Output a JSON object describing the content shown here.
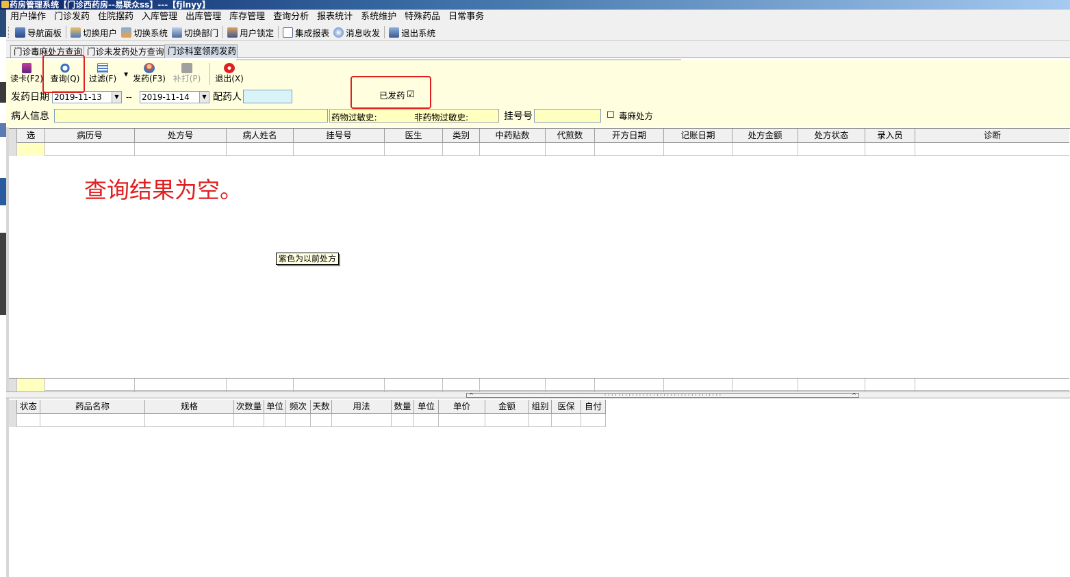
{
  "window": {
    "title": "药房管理系统【门诊西药房--易联众ss】---【fjlnyy】"
  },
  "menu": [
    "用户操作",
    "门诊发药",
    "住院摆药",
    "入库管理",
    "出库管理",
    "库存管理",
    "查询分析",
    "报表统计",
    "系统维护",
    "特殊药品",
    "日常事务"
  ],
  "toolbar": {
    "items": [
      {
        "label": "导航面板",
        "icon": "navigation-panel-icon"
      },
      {
        "label": "切换用户",
        "icon": "switch-user-icon"
      },
      {
        "label": "切换系统",
        "icon": "switch-system-icon"
      },
      {
        "label": "切换部门",
        "icon": "switch-department-icon"
      },
      {
        "label": "用户锁定",
        "icon": "user-lock-icon"
      },
      {
        "label": "集成报表",
        "icon": "report-icon"
      },
      {
        "label": "消息收发",
        "icon": "message-icon"
      },
      {
        "label": "退出系统",
        "icon": "exit-system-icon"
      }
    ]
  },
  "tabs": [
    "门诊毒麻处方查询",
    "门诊未发药处方查询",
    "门诊科室领药发药"
  ],
  "actions": {
    "read_card": "读卡(F2)",
    "query": "查询(Q)",
    "filter": "过滤(F)",
    "dispense": "发药(F3)",
    "reprint": "补打(P)",
    "exit": "退出(X)"
  },
  "filters": {
    "date_label": "发药日期",
    "date_from": "2019-11-13",
    "date_sep": "--",
    "date_to": "2019-11-14",
    "pharmacist_label": "配药人",
    "pharmacist_value": "",
    "dispensed_label": "已发药",
    "dispensed_checked": "☑",
    "patient_label": "病人信息",
    "patient_value": "",
    "drug_allergy_label": "药物过敏史:",
    "non_drug_allergy_label": "非药物过敏史:",
    "reg_no_label": "挂号号",
    "reg_no_value": "",
    "narcotic_label": "毒麻处方",
    "narcotic_checked": "☐"
  },
  "grid1": {
    "columns": [
      "选",
      "病历号",
      "处方号",
      "病人姓名",
      "挂号号",
      "医生",
      "类别",
      "中药贴数",
      "代煎数",
      "开方日期",
      "记账日期",
      "处方金额",
      "处方状态",
      "录入员",
      "诊断"
    ]
  },
  "annotation": "查询结果为空。",
  "tooltip": "紫色为以前处方",
  "grid2": {
    "columns": [
      "状态",
      "药品名称",
      "规格",
      "次数量",
      "单位",
      "频次",
      "天数",
      "用法",
      "数量",
      "单位",
      "单价",
      "金额",
      "组别",
      "医保",
      "自付"
    ]
  },
  "colors": {
    "highlight_box": "#e02020",
    "yellow_panel": "#ffffe0",
    "selected_cell": "#ffffc0"
  }
}
